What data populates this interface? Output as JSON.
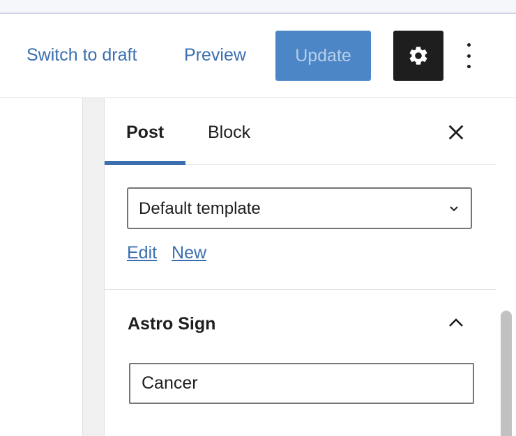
{
  "header": {
    "switch_to_draft": "Switch to draft",
    "preview": "Preview",
    "update": "Update",
    "settings_icon": "gear-icon",
    "more_icon": "vertical-ellipsis-icon"
  },
  "sidebar": {
    "tabs": [
      {
        "label": "Post",
        "active": true
      },
      {
        "label": "Block",
        "active": false
      }
    ],
    "close_icon": "close-icon",
    "template": {
      "selected": "Default template",
      "edit_link": "Edit",
      "new_link": "New"
    },
    "astro_panel": {
      "title": "Astro Sign",
      "expanded": true,
      "input_value": "Cancer"
    }
  },
  "colors": {
    "accent": "#3b6fb0",
    "update_button": "#4c86c6",
    "settings_button": "#1e1e1e"
  }
}
